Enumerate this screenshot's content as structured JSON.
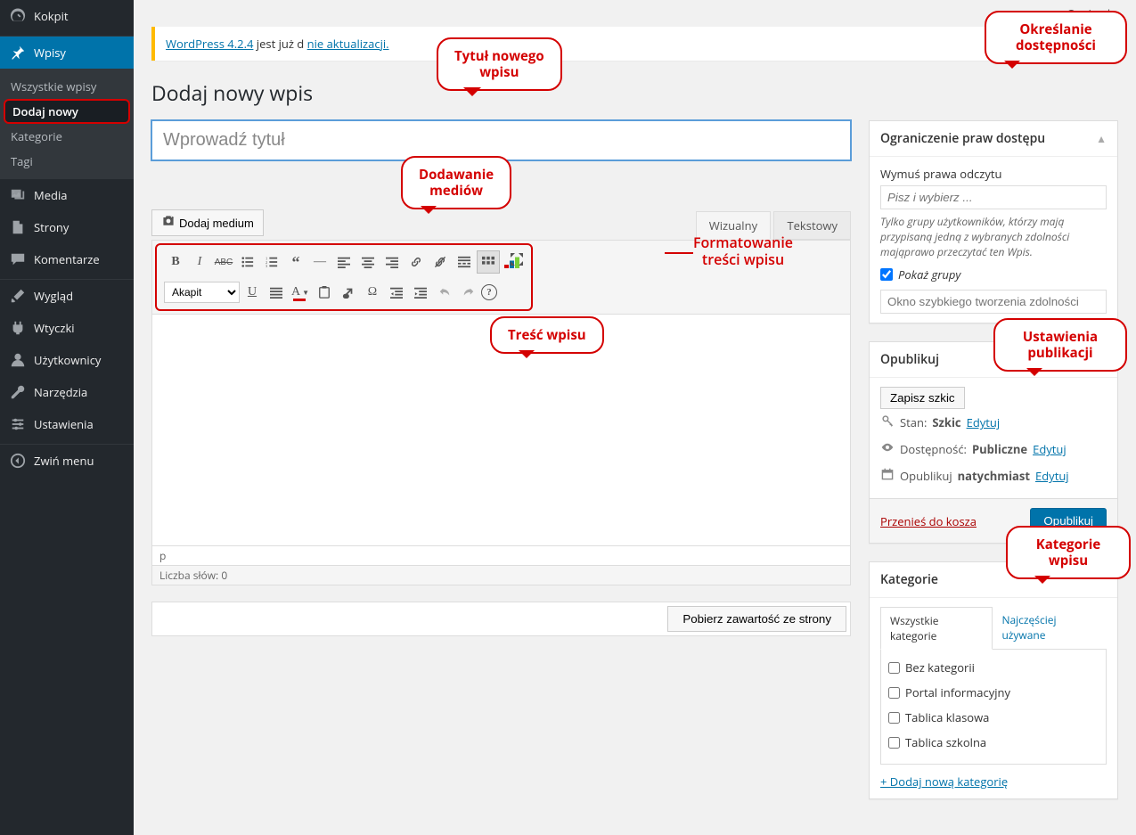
{
  "topbar": {
    "options": "Opcje ekr"
  },
  "sidebar": {
    "kokpit": "Kokpit",
    "wpisy": "Wpisy",
    "sub_all": "Wszystkie wpisy",
    "sub_add": "Dodaj nowy",
    "sub_cat": "Kategorie",
    "sub_tag": "Tagi",
    "media": "Media",
    "strony": "Strony",
    "komentarze": "Komentarze",
    "wyglad": "Wygląd",
    "wtyczki": "Wtyczki",
    "uzytkownicy": "Użytkownicy",
    "narzedzia": "Narzędzia",
    "ustawienia": "Ustawienia",
    "zwin": "Zwiń menu"
  },
  "nag": {
    "link": "WordPress 4.2.4",
    "text1": " jest już d",
    "link2": "nie aktualizacji.",
    "gap": "                              "
  },
  "page_title": "Dodaj nowy wpis",
  "title_placeholder": "Wprowadź tytuł",
  "media_button": "Dodaj medium",
  "tabs": {
    "visual": "Wizualny",
    "text": "Tekstowy"
  },
  "toolbar": {
    "paragraph": "Akapit"
  },
  "status_p": "p",
  "word_count": "Liczba słów: 0",
  "fetch_button": "Pobierz zawartość ze strony",
  "box_access": {
    "title": "Ograniczenie praw dostępu",
    "force_label": "Wymuś prawa odczytu",
    "force_placeholder": "Pisz i wybierz ...",
    "desc": "Tylko grupy użytkowników, którzy mają przypisaną jedną z wybranych zdolności mająprawo przeczytać ten Wpis.",
    "show_groups": "Pokaż grupy",
    "quick_placeholder": "Okno szybkiego tworzenia zdolności"
  },
  "box_pub": {
    "title": "Opublikuj",
    "save_draft": "Zapisz szkic",
    "state_label": "Stan:",
    "state_value": "Szkic",
    "avail_label": "Dostępność:",
    "avail_value": "Publiczne",
    "pub_label": "Opublikuj",
    "pub_value": "natychmiast",
    "edit": "Edytuj",
    "trash": "Przenieś do kosza",
    "publish": "Opublikuj"
  },
  "box_cat": {
    "title": "Kategorie",
    "tab_all": "Wszystkie kategorie",
    "tab_used": "Najczęściej używane",
    "items": [
      "Bez kategorii",
      "Portal informacyjny",
      "Tablica klasowa",
      "Tablica szkolna"
    ],
    "add": "+ Dodaj nową kategorię"
  },
  "callouts": {
    "title": "Tytuł nowego wpisu",
    "media": "Dodawanie mediów",
    "content": "Treść wpisu",
    "format": "Formatowanie treści wpisu",
    "access": "Określanie dostępności",
    "pub": "Ustawienia publikacji",
    "cat": "Kategorie wpisu"
  }
}
